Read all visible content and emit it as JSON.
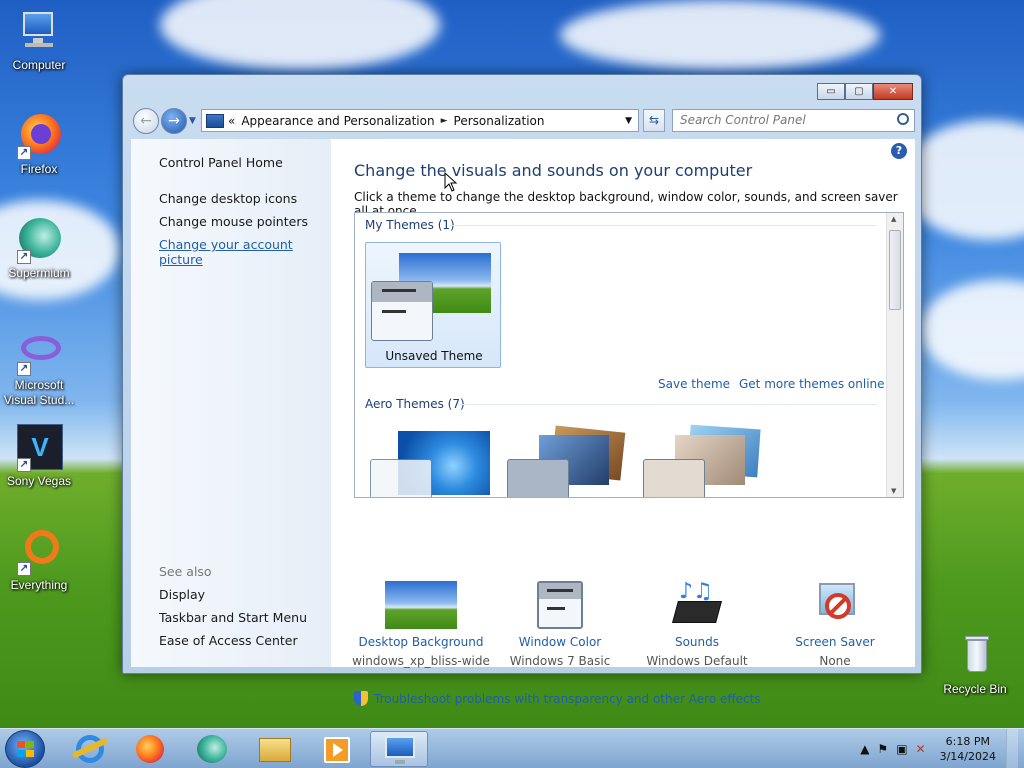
{
  "desktop": {
    "icons": [
      {
        "label": "Computer",
        "icon": "computer-icon"
      },
      {
        "label": "Firefox",
        "icon": "firefox-icon"
      },
      {
        "label": "Supermium",
        "icon": "supermium-icon"
      },
      {
        "label": "Microsoft Visual Stud...",
        "icon": "visual-studio-icon"
      },
      {
        "label": "Sony Vegas",
        "icon": "sony-vegas-icon"
      },
      {
        "label": "Everything",
        "icon": "everything-icon"
      },
      {
        "label": "Recycle Bin",
        "icon": "recycle-bin-icon"
      }
    ]
  },
  "window": {
    "caption": {
      "minimize": "▭",
      "maximize": "▢",
      "close": "✕"
    },
    "address": {
      "overflow": "«",
      "crumbs": [
        "Appearance and Personalization",
        "Personalization"
      ],
      "separator": "►"
    },
    "search": {
      "placeholder": "Search Control Panel"
    },
    "left_pane": {
      "home": "Control Panel Home",
      "links": [
        "Change desktop icons",
        "Change mouse pointers",
        "Change your account picture"
      ],
      "see_also_title": "See also",
      "see_also": [
        "Display",
        "Taskbar and Start Menu",
        "Ease of Access Center"
      ]
    },
    "main": {
      "title": "Change the visuals and sounds on your computer",
      "subtitle": "Click a theme to change the desktop background, window color, sounds, and screen saver all at once.",
      "my_themes_header": "My Themes (1)",
      "unsaved_theme": "Unsaved Theme",
      "save_theme": "Save theme",
      "get_more": "Get more themes online",
      "aero_header": "Aero Themes (7)",
      "bottom": [
        {
          "label": "Desktop Background",
          "value": "windows_xp_bliss-wide",
          "icon": "desktop-background-icon"
        },
        {
          "label": "Window Color",
          "value": "Windows 7 Basic",
          "icon": "window-color-icon"
        },
        {
          "label": "Sounds",
          "value": "Windows Default",
          "icon": "sounds-icon"
        },
        {
          "label": "Screen Saver",
          "value": "None",
          "icon": "screen-saver-icon"
        }
      ],
      "troubleshoot": "Troubleshoot problems with transparency and other Aero effects"
    }
  },
  "taskbar": {
    "apps": [
      "Internet Explorer",
      "Firefox",
      "Supermium",
      "Windows Explorer",
      "Media Player",
      "Personalization"
    ],
    "clock": {
      "time": "6:18 PM",
      "date": "3/14/2024"
    }
  },
  "colors": {
    "link": "#1f5fa8",
    "title": "#1e3f73",
    "taskbar": "#8fb1d8"
  }
}
